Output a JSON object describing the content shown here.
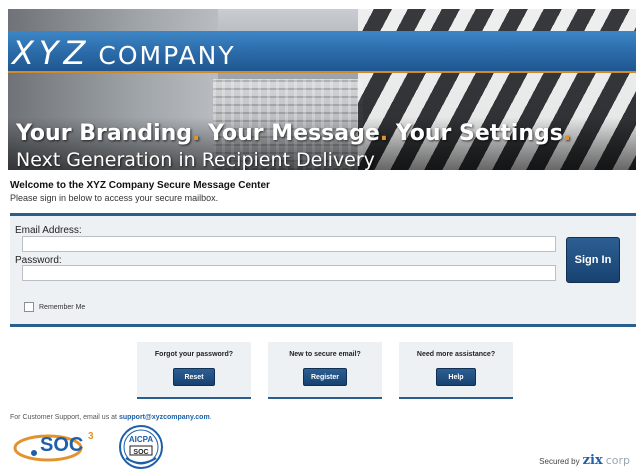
{
  "banner": {
    "company_xyz": "XYZ",
    "company_word": "COMPANY",
    "tag_part1": "Your Branding",
    "tag_part2": "Your Message",
    "tag_part3": "Your Settings",
    "tag_sep": ".",
    "subtitle": "Next Generation in Recipient Delivery"
  },
  "welcome": {
    "title": "Welcome to the XYZ Company Secure Message Center",
    "subtitle": "Please sign in below to access your secure mailbox."
  },
  "login": {
    "email_label": "Email Address:",
    "email_value": "",
    "password_label": "Password:",
    "password_value": "",
    "sign_in_label": "Sign In",
    "remember_label": "Remember Me",
    "remember_checked": false
  },
  "help": {
    "forgot_question": "Forgot your password?",
    "reset_label": "Reset",
    "new_question": "New to secure email?",
    "register_label": "Register",
    "assist_question": "Need more assistance?",
    "help_label": "Help"
  },
  "footer": {
    "support_text": "For Customer Support, email us at",
    "support_email": "support@xyzcompany.com",
    "support_end": ".",
    "soc_text": "SOC",
    "soc_sup": "3",
    "aicpa_text": "AICPA",
    "aicpa_inner": "SOC",
    "secured_by": "Secured by",
    "zix": "zix",
    "corp": "corp"
  },
  "colors": {
    "brand_blue": "#2a5e8f",
    "button_blue": "#174270",
    "accent_orange": "#e3932e",
    "panel_bg": "#eef1f4"
  }
}
